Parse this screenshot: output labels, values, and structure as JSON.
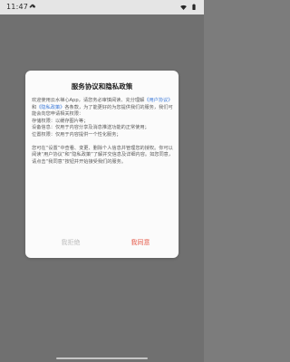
{
  "status_bar": {
    "time": "11:47",
    "left_icon": "cloud-download-icon",
    "wifi_icon": "wifi-icon",
    "battery_icon": "battery-icon"
  },
  "dialog": {
    "title": "服务协议和隐私政策",
    "paragraphs": {
      "p1_before_link1": "欢迎使用云水禅心App，请您务必审慎阅读、充分理解",
      "link_user_agreement": "《用户协议》",
      "p1_mid": "和",
      "link_privacy_policy": "《隐私政策》",
      "p1_after_links": "各条款，为了能更好的为您提供我们的服务，我们可能会向您申请相关权限：",
      "p2_storage": "存储权限：以缓存图片等；",
      "p3_device": "设备信息：仅用于内容分享及消息推送功能的正常使用；",
      "p4_location": "位置权限：仅用于内容提供一个性化服务；",
      "p5_manage": "您可在“设置”中查看、变更、删除个人信息并管理您的授权。你可以阅读“用户协议”和“隐私政策”了解并交信息及详细内容。如您同意，请点击“我同意”按钮并开始接受我们的服务。"
    },
    "buttons": {
      "reject": "我拒绝",
      "agree": "我同意"
    }
  },
  "colors": {
    "background_overlay": "#7c7c7c",
    "dialog_bg": "#fbfbfb",
    "title_text": "#222222",
    "body_text": "#5b5b5b",
    "link": "#3a78d8",
    "reject_text": "#bdbdbd",
    "agree_text": "#e55b4b"
  }
}
